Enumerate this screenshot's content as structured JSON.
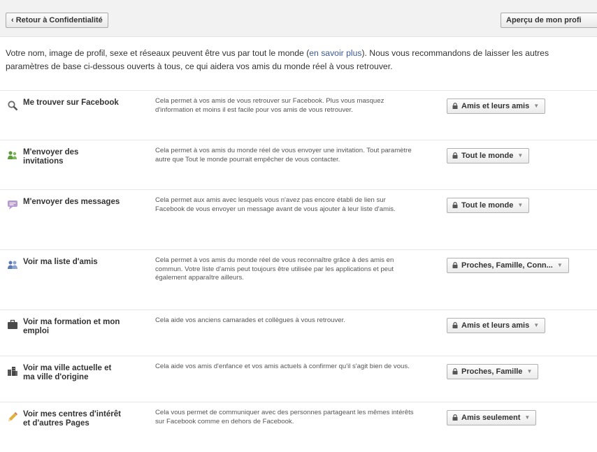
{
  "toolbar": {
    "back_label": "‹ Retour à Confidentialité",
    "preview_label": "Aperçu de mon profi"
  },
  "intro": {
    "text_before": "Votre nom, image de profil, sexe et réseaux peuvent être vus par tout le monde (",
    "link": "en savoir plus",
    "text_after": "). Nous vous recommandons de laisser les autres paramètres de base ci-dessous ouverts à tous, ce qui aidera vos amis du monde réel à vous retrouver."
  },
  "settings": [
    {
      "icon": "search-icon",
      "title": "Me trouver sur Facebook",
      "description": "Cela permet à vos amis de vous retrouver sur Facebook. Plus vous masquez d'information et moins il est facile pour vos amis de vous retrouver.",
      "value": "Amis et leurs amis"
    },
    {
      "icon": "friend-request-icon",
      "title": "M'envoyer des invitations",
      "description": "Cela permet à vos amis du monde réel de vous envoyer une invitation. Tout paramètre autre que Tout le monde pourrait empêcher de vous contacter.",
      "value": "Tout le monde"
    },
    {
      "icon": "message-icon",
      "title": "M'envoyer des messages",
      "description": "Cela permet aux amis avec lesquels vous n'avez pas encore établi de lien sur Facebook de vous envoyer un message avant de vous ajouter à leur liste d'amis.",
      "value": "Tout le monde"
    },
    {
      "icon": "friends-list-icon",
      "title": "Voir ma liste d'amis",
      "description": "Cela permet à vos amis du monde réel de vous reconnaître grâce à des amis en commun. Votre liste d'amis peut toujours être utilisée par les applications et peut également apparaître ailleurs.",
      "value": "Proches, Famille, Conn..."
    },
    {
      "icon": "briefcase-icon",
      "title": "Voir ma formation et mon emploi",
      "description": "Cela aide vos anciens camarades et collègues à vous retrouver.",
      "value": "Amis et leurs amis"
    },
    {
      "icon": "city-icon",
      "title": "Voir ma ville actuelle et ma ville d'origine",
      "description": "Cela aide vos amis d'enfance et vos amis actuels à confirmer qu'il s'agit bien de vous.",
      "value": "Proches, Famille"
    },
    {
      "icon": "pencil-icon",
      "title": "Voir mes centres d'intérêt et d'autres Pages",
      "description": "Cela vous permet de communiquer avec des personnes partageant les mêmes intérêts sur Facebook comme en dehors de Facebook.",
      "value": "Amis seulement"
    }
  ],
  "colors": {
    "link": "#3b5998",
    "topbar_bg": "#f2f2f2"
  }
}
